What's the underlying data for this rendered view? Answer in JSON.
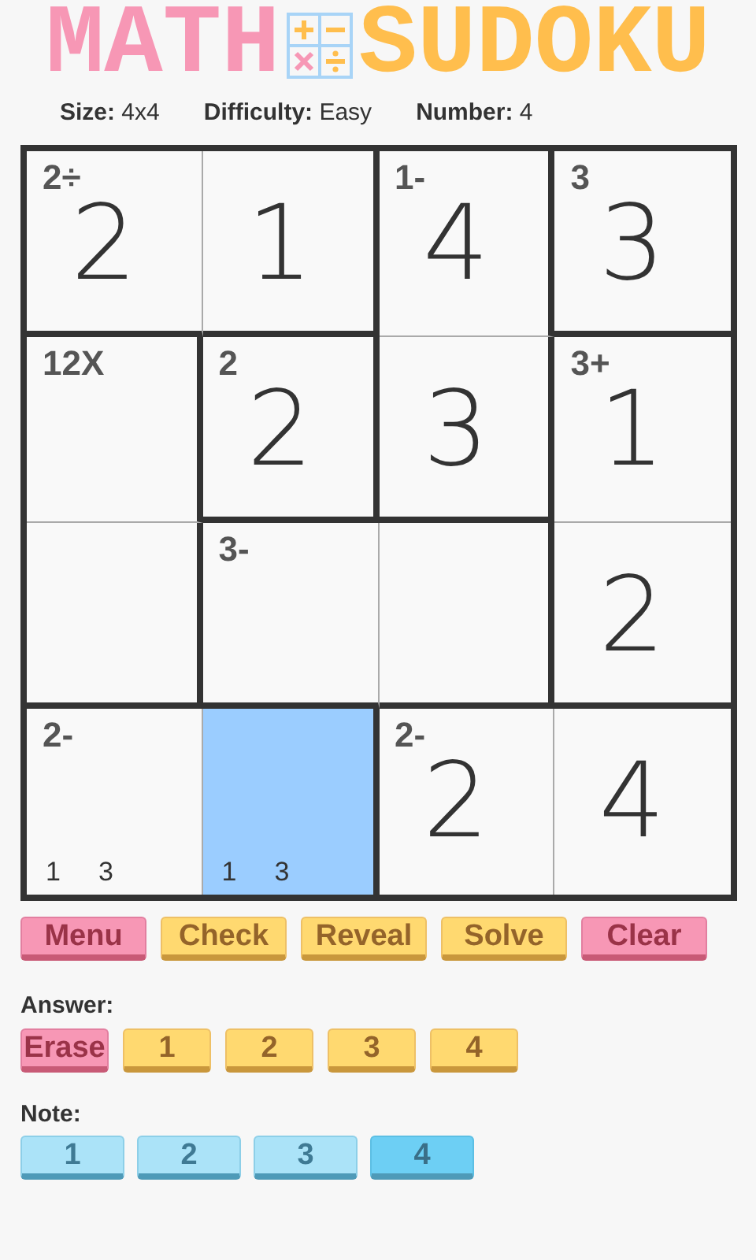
{
  "logo": {
    "left": "MATH",
    "right": "SUDOKU"
  },
  "info": [
    "**Size:** 4x4",
    "**Difficulty:** Easy",
    "**Number:** 4"
  ],
  "board": [
    [
      {
        "wall_right": false,
        "wall_bottom": true,
        "label": "2÷",
        "value": "2",
        "selected": false
      },
      {
        "wall_right": true,
        "wall_bottom": true,
        "value": "1",
        "selected": false
      },
      {
        "wall_right": true,
        "wall_bottom": false,
        "label": "1-",
        "value": "4",
        "selected": false
      },
      {
        "wall_bottom": true,
        "label": "3",
        "value": "3",
        "selected": false
      }
    ],
    [
      {
        "wall_right": true,
        "wall_bottom": false,
        "label": "12X",
        "selected": false
      },
      {
        "wall_right": true,
        "wall_bottom": true,
        "label": "2",
        "value": "2",
        "selected": false
      },
      {
        "wall_right": true,
        "wall_bottom": true,
        "value": "3",
        "selected": false
      },
      {
        "wall_bottom": false,
        "label": "3+",
        "value": "1",
        "selected": false
      }
    ],
    [
      {
        "wall_right": true,
        "wall_bottom": true,
        "selected": false
      },
      {
        "wall_right": false,
        "wall_bottom": true,
        "label": "3-",
        "selected": false
      },
      {
        "wall_right": true,
        "wall_bottom": true,
        "selected": false
      },
      {
        "wall_bottom": true,
        "value": "2",
        "selected": false
      }
    ],
    [
      {
        "wall_right": false,
        "label": "2-",
        "notes": [
          "1",
          "3"
        ],
        "selected": false
      },
      {
        "wall_right": true,
        "notes": [
          "1",
          "3"
        ],
        "selected": true
      },
      {
        "wall_right": false,
        "label": "2-",
        "value": "2",
        "selected": false
      },
      {
        "value": "4",
        "selected": false
      }
    ]
  ],
  "actions": [
    {
      "label": "Menu",
      "kind": "pink"
    },
    {
      "label": "Check",
      "kind": "yellow"
    },
    {
      "label": "Reveal",
      "kind": "yellow"
    },
    {
      "label": "Solve",
      "kind": "yellow"
    },
    {
      "label": "Clear",
      "kind": "pink"
    }
  ],
  "answer": {
    "title": "Answer:",
    "buttons": [
      {
        "label": "Erase",
        "kind": "erase"
      },
      {
        "label": "1",
        "kind": "digit"
      },
      {
        "label": "2",
        "kind": "digit"
      },
      {
        "label": "3",
        "kind": "digit"
      },
      {
        "label": "4",
        "kind": "digit"
      }
    ]
  },
  "note": {
    "title": "Note:",
    "buttons": [
      {
        "label": "1",
        "selected": false
      },
      {
        "label": "2",
        "selected": false
      },
      {
        "label": "3",
        "selected": false
      },
      {
        "label": "4",
        "selected": true
      }
    ]
  }
}
